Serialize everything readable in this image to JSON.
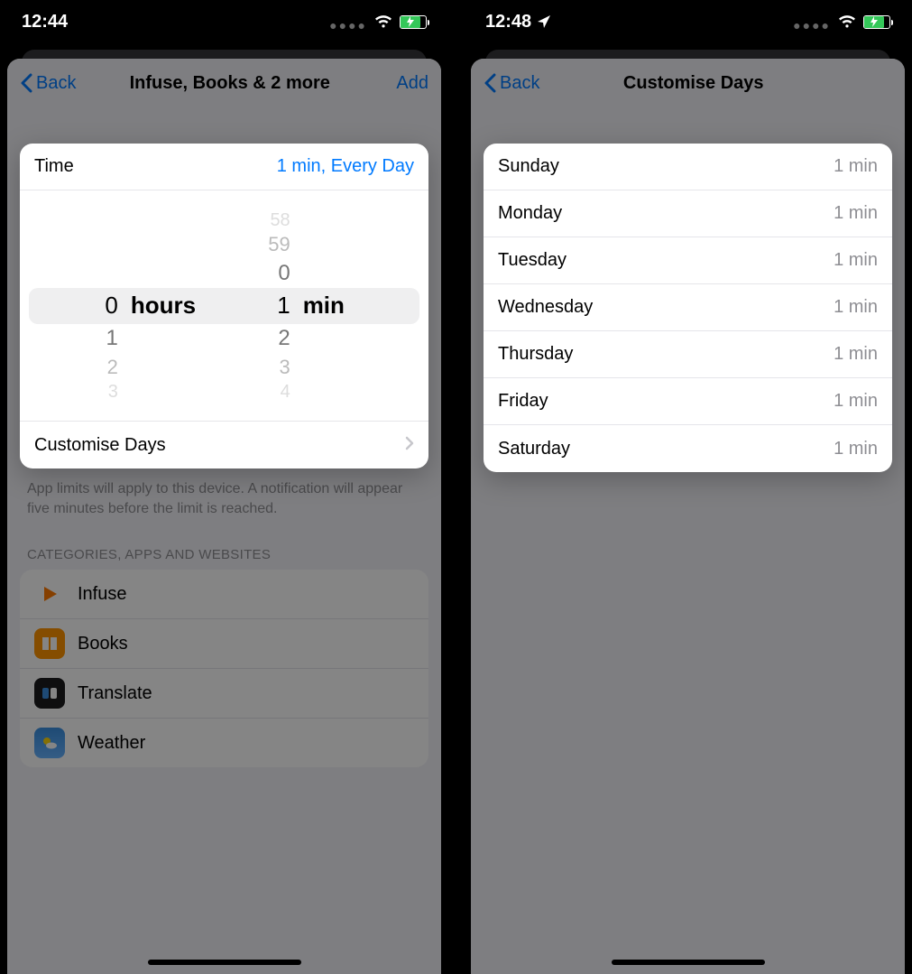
{
  "left": {
    "status": {
      "time": "12:44"
    },
    "nav": {
      "back": "Back",
      "title": "Infuse, Books & 2 more",
      "action": "Add"
    },
    "time_row": {
      "label": "Time",
      "value": "1 min, Every Day"
    },
    "picker": {
      "hours": {
        "selected": "0",
        "below": [
          "1",
          "2",
          "3"
        ],
        "label": "hours"
      },
      "mins": {
        "selected": "1",
        "above": [
          "0",
          "59",
          "58"
        ],
        "below": [
          "2",
          "3",
          "4"
        ],
        "label": "min"
      }
    },
    "customise": "Customise Days",
    "footer": "App limits will apply to this device. A notification will appear five minutes before the limit is reached.",
    "section": "CATEGORIES, APPS AND WEBSITES",
    "apps": [
      {
        "name": "Infuse"
      },
      {
        "name": "Books"
      },
      {
        "name": "Translate"
      },
      {
        "name": "Weather"
      }
    ]
  },
  "right": {
    "status": {
      "time": "12:48"
    },
    "nav": {
      "back": "Back",
      "title": "Customise Days"
    },
    "days": [
      {
        "name": "Sunday",
        "value": "1 min"
      },
      {
        "name": "Monday",
        "value": "1 min"
      },
      {
        "name": "Tuesday",
        "value": "1 min"
      },
      {
        "name": "Wednesday",
        "value": "1 min"
      },
      {
        "name": "Thursday",
        "value": "1 min"
      },
      {
        "name": "Friday",
        "value": "1 min"
      },
      {
        "name": "Saturday",
        "value": "1 min"
      }
    ]
  }
}
